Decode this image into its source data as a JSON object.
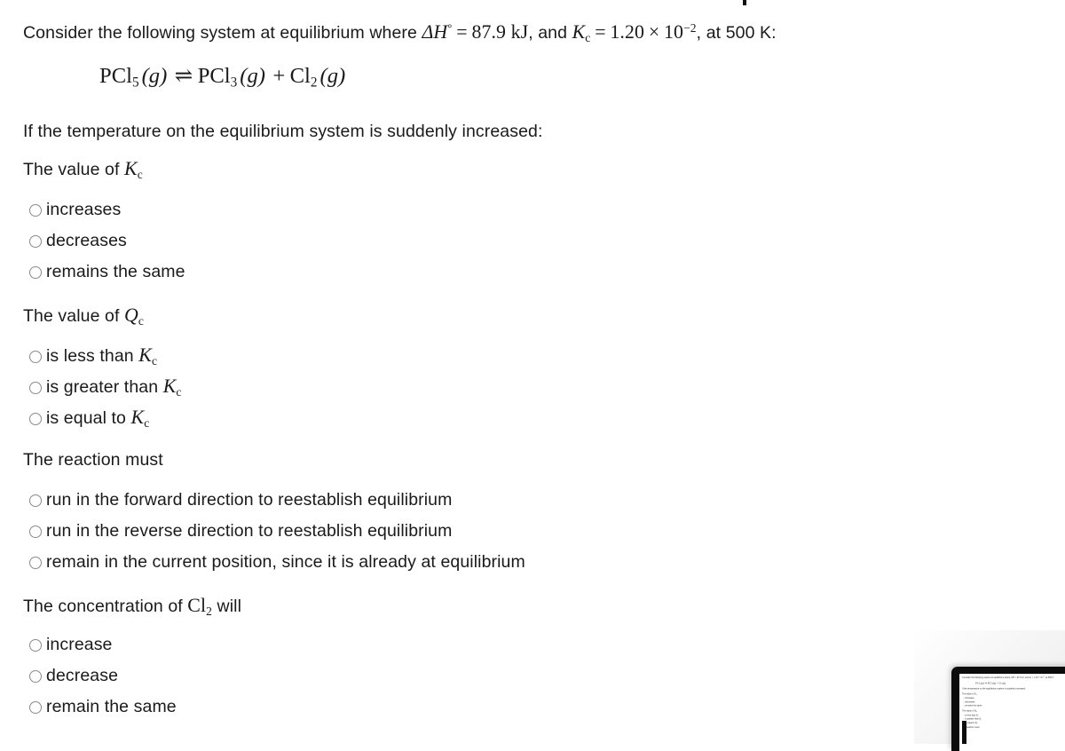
{
  "document": {
    "stem": {
      "lead": "Consider the following system at equilibrium where",
      "delta_h_symbol": "ΔH",
      "delta_h_degree": "°",
      "equals": "=",
      "delta_h_value": "87.9",
      "delta_h_unit": "kJ",
      "conjunction": ", and",
      "kc_symbol": "K",
      "kc_subscript": "c",
      "kc_equals": "=",
      "kc_mantissa": "1.20",
      "kc_times": "×",
      "kc_base": "10",
      "kc_exponent": "−2",
      "temperature_phrase": ", at 500 K:"
    },
    "equation": {
      "reactant_formula": "PCl",
      "reactant_sub": "5",
      "reactant_state": "(g)",
      "arrow": "⇌",
      "product1_formula": "PCl",
      "product1_sub": "3",
      "product1_state": "(g)",
      "plus": "+",
      "product2_formula": "Cl",
      "product2_sub": "2",
      "product2_state": "(g)"
    },
    "condition": "If the temperature on the equilibrium system is suddenly increased:",
    "questions": [
      {
        "prompt_prefix": "The value of ",
        "prompt_symbol": "K",
        "prompt_subscript": "c",
        "options": [
          {
            "label": "increases"
          },
          {
            "label": "decreases"
          },
          {
            "label": "remains the same"
          }
        ]
      },
      {
        "prompt_prefix": "The value of ",
        "prompt_symbol": "Q",
        "prompt_subscript": "c",
        "options": [
          {
            "prefix": "is less than ",
            "symbol": "K",
            "subscript": "c"
          },
          {
            "prefix": "is greater than ",
            "symbol": "K",
            "subscript": "c"
          },
          {
            "prefix": "is equal to ",
            "symbol": "K",
            "subscript": "c"
          }
        ]
      },
      {
        "prompt_plain": "The reaction must",
        "options": [
          {
            "label": "run in the forward direction to reestablish equilibrium"
          },
          {
            "label": "run in the reverse direction to reestablish equilibrium"
          },
          {
            "label": "remain in the current position, since it is already at equilibrium"
          }
        ]
      },
      {
        "prompt_prefix": "The concentration of ",
        "prompt_symbol": "Cl",
        "prompt_subscript": "2",
        "prompt_suffix": " will",
        "options": [
          {
            "label": "increase"
          },
          {
            "label": "decrease"
          },
          {
            "label": "remain the same"
          }
        ]
      }
    ]
  },
  "colors": {
    "page_background": "#ffffff",
    "text": "#1a1a1a",
    "radio_border": "#8a8a8a",
    "device_bezel": "#0c0c0c",
    "mock_background": "#ececec"
  }
}
